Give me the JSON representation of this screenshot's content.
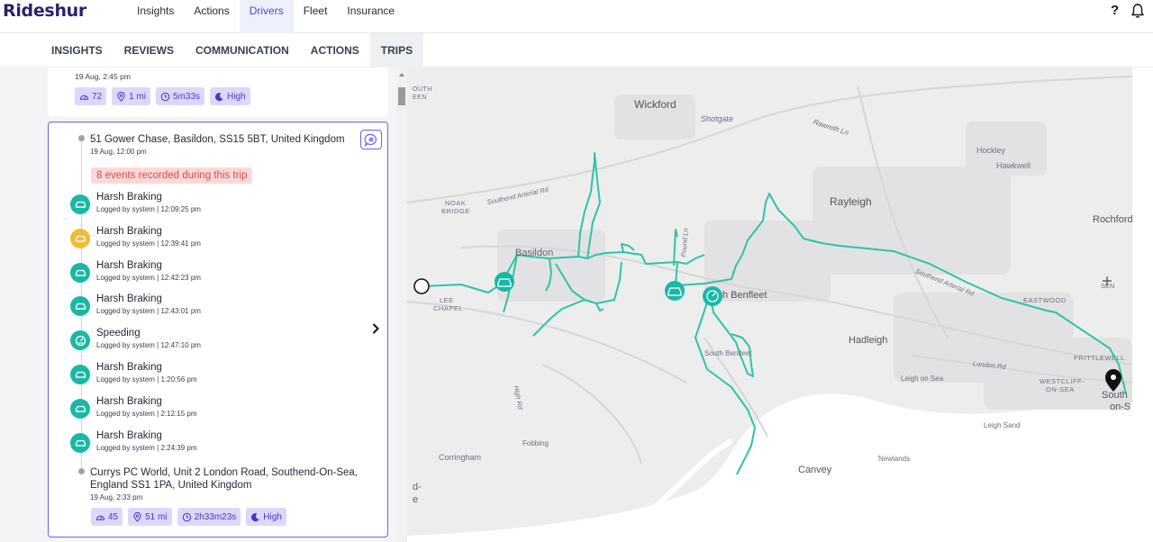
{
  "app": {
    "brand": "Rideshur",
    "help": "?"
  },
  "nav": [
    {
      "label": "Insights",
      "active": false
    },
    {
      "label": "Actions",
      "active": false
    },
    {
      "label": "Drivers",
      "active": true
    },
    {
      "label": "Fleet",
      "active": false
    },
    {
      "label": "Insurance",
      "active": false
    }
  ],
  "subtabs": [
    {
      "label": "INSIGHTS"
    },
    {
      "label": "REVIEWS"
    },
    {
      "label": "COMMUNICATION"
    },
    {
      "label": "ACTIONS"
    },
    {
      "label": "TRIPS",
      "active": true
    }
  ],
  "prev_trip": {
    "date": "19 Aug, 2:45 pm",
    "score": "72",
    "distance": "1 mi",
    "duration": "5m33s",
    "risk": "High"
  },
  "trip": {
    "start_address": "51 Gower Chase, Basildon, SS15 5BT, United Kingdom",
    "start_date": "19 Aug, 12:00 pm",
    "events_summary": "8 events recorded during this trip",
    "events": [
      {
        "title": "Harsh Braking",
        "meta": "Logged by system | 12:09:25 pm",
        "icon": "car-icon",
        "color": "#19b8a6"
      },
      {
        "title": "Harsh Braking",
        "meta": "Logged by system | 12:39:41 pm",
        "icon": "car-icon",
        "color": "#f4b936"
      },
      {
        "title": "Harsh Braking",
        "meta": "Logged by system | 12:42:23 pm",
        "icon": "car-icon",
        "color": "#19b8a6"
      },
      {
        "title": "Harsh Braking",
        "meta": "Logged by system | 12:43:01 pm",
        "icon": "car-icon",
        "color": "#19b8a6"
      },
      {
        "title": "Speeding",
        "meta": "Logged by system | 12:47:10 pm",
        "icon": "speedometer-icon",
        "color": "#19b8a6"
      },
      {
        "title": "Harsh Braking",
        "meta": "Logged by system | 1:20:56 pm",
        "icon": "car-icon",
        "color": "#19b8a6"
      },
      {
        "title": "Harsh Braking",
        "meta": "Logged by system | 2:12:15 pm",
        "icon": "car-icon",
        "color": "#19b8a6"
      },
      {
        "title": "Harsh Braking",
        "meta": "Logged by system | 2:24:39 pm",
        "icon": "car-icon",
        "color": "#19b8a6"
      }
    ],
    "end_address_line1": "Currys PC World, Unit 2 London Road, Southend-On-Sea,",
    "end_address_line2": "England SS1 1PA, United Kingdom",
    "end_date": "19 Aug, 2:33 pm",
    "score": "45",
    "distance": "51 mi",
    "duration": "2h33m23s",
    "risk": "High"
  },
  "map": {
    "route_color": "#2ec4a4",
    "labels": {
      "wickford": "Wickford",
      "shotgate": "Shotgate",
      "rawreth": "Rawreth Ln",
      "hockley": "Hockley",
      "hawkwell": "Hawkwell",
      "rayleigh": "Rayleigh",
      "rochford": "Rochford",
      "noak_bridge1": "NOAK",
      "noak_bridge2": "BRIDGE",
      "southend_arterial": "Southend Arterial Rd",
      "southend_arterial2": "Southend Arterial Rd",
      "basildon": "Basildon",
      "pound_ln": "Pound Ln",
      "lee_chapel1": "LEE",
      "lee_chapel2": "CHAPEL",
      "benfleet": "h Benfleet",
      "eastwood": "EASTWOOD",
      "sen": "SEN",
      "hadleigh": "Hadleigh",
      "south_benfleet": "South Benfleet",
      "london_rd": "London Rd",
      "prittlewell": "PRITTLEWELL",
      "leigh_on_sea": "Leigh on Sea",
      "westcliff1": "WESTCLIFF-",
      "westcliff2": "ON-SEA",
      "southend1": "South",
      "southend2": "on-S",
      "high_rd": "High Rd",
      "leigh_sand": "Leigh Sand",
      "fobbing": "Fobbing",
      "corringham": "Corringham",
      "newlands": "Newlands",
      "canvey": "Canvey",
      "south_top1": "OUTH",
      "south_top2": "EEN",
      "edge1": "d-",
      "edge2": "e"
    }
  }
}
